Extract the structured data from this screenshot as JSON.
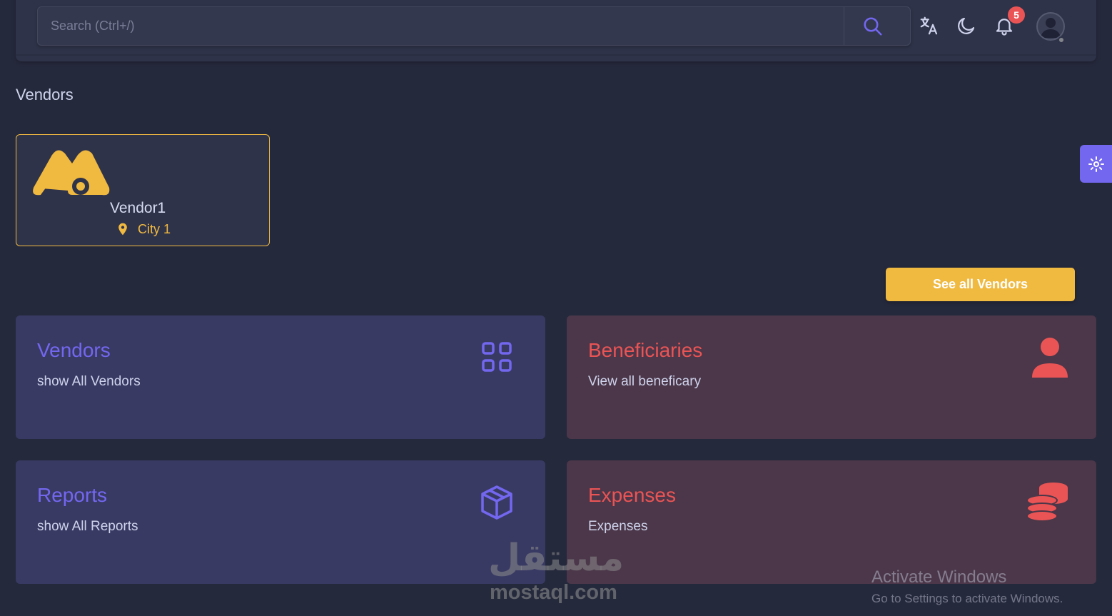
{
  "header": {
    "search_placeholder": "Search (Ctrl+/)",
    "notification_count": "5"
  },
  "page": {
    "title": "Vendors"
  },
  "vendor_card": {
    "name": "Vendor1",
    "city": "City 1"
  },
  "see_all_label": "See all Vendors",
  "stat_cards": [
    {
      "title": "Vendors",
      "subtitle": "show All Vendors",
      "icon": "grid-icon"
    },
    {
      "title": "Beneficiaries",
      "subtitle": "View all beneficary",
      "icon": "user-icon"
    },
    {
      "title": "Reports",
      "subtitle": "show All Reports",
      "icon": "box-icon"
    },
    {
      "title": "Expenses",
      "subtitle": "Expenses",
      "icon": "coins-icon"
    }
  ],
  "watermark": {
    "arabic": "مستقل",
    "latin": "mostaql.com"
  },
  "windows_activation": {
    "title": "Activate Windows",
    "subtitle": "Go to Settings to activate Windows."
  },
  "colors": {
    "background": "#25293c",
    "card": "#2f3349",
    "primary": "#7367f0",
    "danger": "#ea5455",
    "warning": "#f0b940"
  }
}
